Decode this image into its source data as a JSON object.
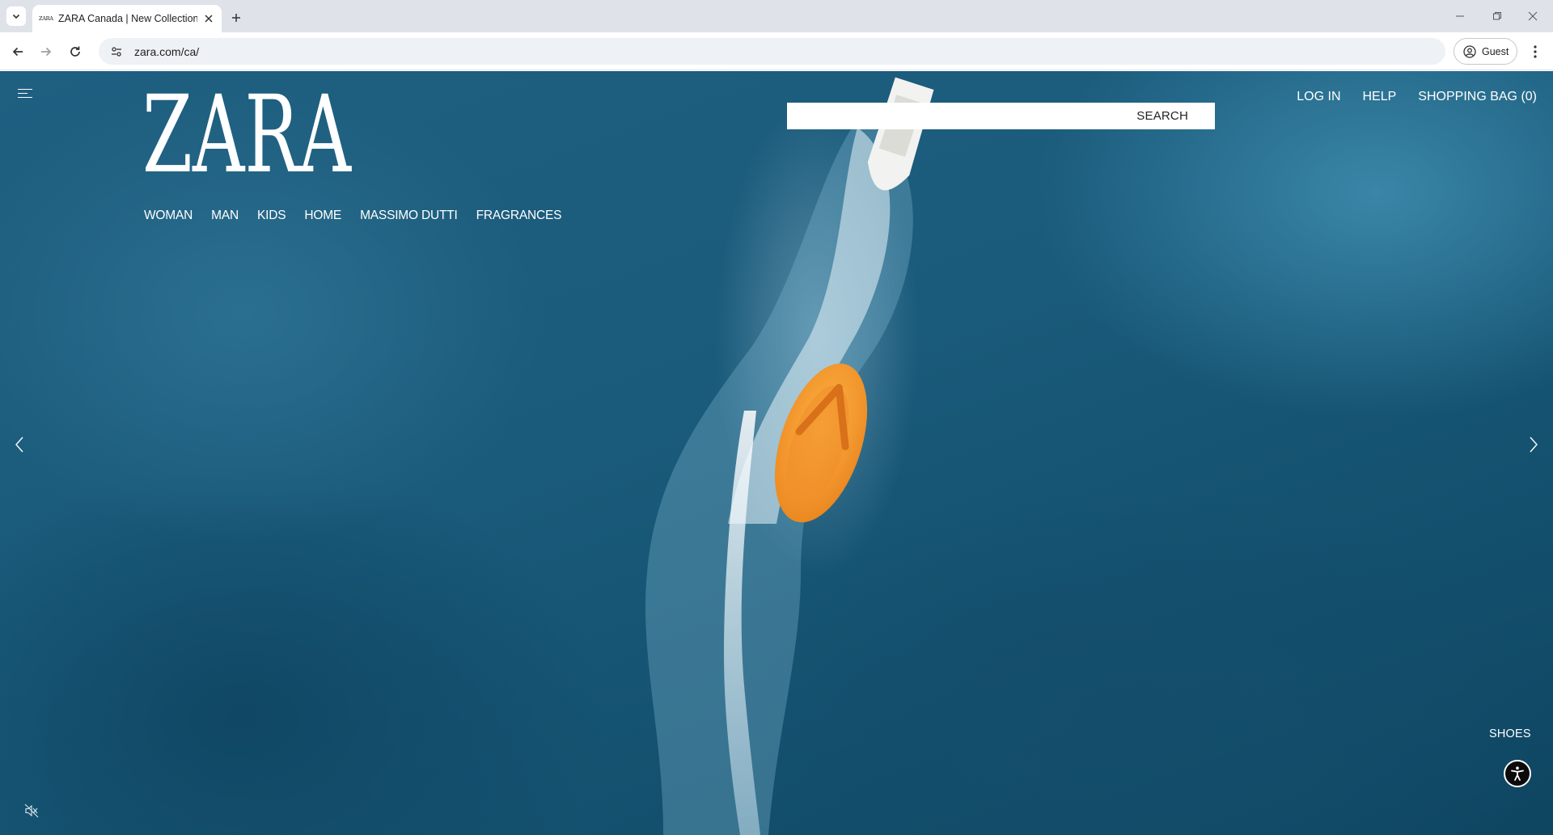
{
  "browser": {
    "tab": {
      "favicon_text": "ZARA",
      "title": "ZARA Canada | New Collection"
    },
    "url": "zara.com/ca/",
    "profile_label": "Guest"
  },
  "page": {
    "logo_text": "ZARA",
    "nav_items": [
      "WOMAN",
      "MAN",
      "KIDS",
      "HOME",
      "MASSIMO DUTTI",
      "FRAGRANCES"
    ],
    "search_label": "SEARCH",
    "top_links": {
      "login": "LOG IN",
      "help": "HELP",
      "shopping_bag": "SHOPPING BAG (0)"
    },
    "section_tag": "SHOES",
    "icons": {
      "menu": "hamburger-icon",
      "prev": "chevron-left-icon",
      "next": "chevron-right-icon",
      "accessibility": "accessibility-icon",
      "mute": "muted-speaker-icon"
    },
    "colors": {
      "ocean": "#1a5a7a",
      "sandal": "#f39a2b",
      "overlay_text": "#ffffff"
    }
  }
}
